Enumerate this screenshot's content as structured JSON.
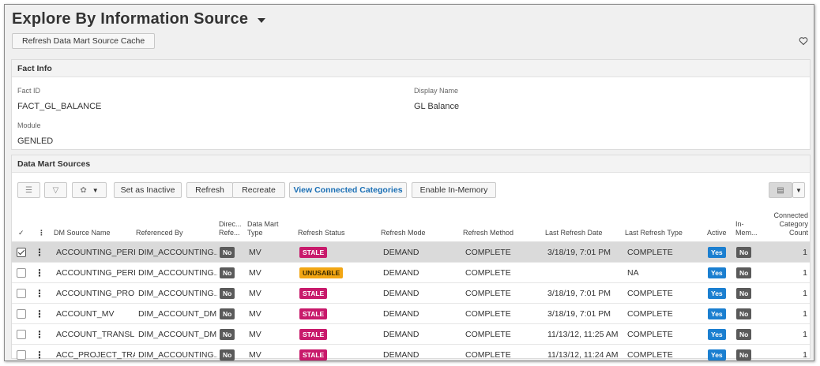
{
  "page": {
    "title": "Explore By Information Source",
    "refresh_cache_label": "Refresh Data Mart Source Cache"
  },
  "fact_info": {
    "header": "Fact Info",
    "fact_id_label": "Fact ID",
    "fact_id_value": "FACT_GL_BALANCE",
    "display_name_label": "Display Name",
    "display_name_value": "GL Balance",
    "module_label": "Module",
    "module_value": "GENLED"
  },
  "data_mart": {
    "header": "Data Mart Sources",
    "toolbar": {
      "set_inactive": "Set as Inactive",
      "refresh": "Refresh",
      "recreate": "Recreate",
      "view_connected": "View Connected Categories",
      "enable_in_memory": "Enable In-Memory"
    },
    "columns": {
      "check": "✓",
      "more": "⋮",
      "dm_source_name": "DM Source Name",
      "referenced_by": "Referenced By",
      "direct_ref_1": "Direc...",
      "direct_ref_2": "Refe...",
      "dm_type_1": "Data Mart",
      "dm_type_2": "Type",
      "refresh_status": "Refresh Status",
      "refresh_mode": "Refresh Mode",
      "refresh_method": "Refresh Method",
      "last_refresh_date": "Last Refresh Date",
      "last_refresh_type": "Last Refresh Type",
      "active": "Active",
      "in_memory_1": "In-",
      "in_memory_2": "Mem...",
      "conn_count_1": "Connected",
      "conn_count_2": "Category",
      "conn_count_3": "Count"
    },
    "rows": [
      {
        "selected": true,
        "name": "ACCOUNTING_PERI...",
        "ref_by": "DIM_ACCOUNTING...",
        "direct": "No",
        "type": "MV",
        "status": "STALE",
        "status_kind": "stale",
        "mode": "DEMAND",
        "method": "COMPLETE",
        "date": "3/18/19, 7:01 PM",
        "rtype": "COMPLETE",
        "active": "Yes",
        "inmem": "No",
        "count": "1"
      },
      {
        "selected": false,
        "name": "ACCOUNTING_PERI...",
        "ref_by": "DIM_ACCOUNTING...",
        "direct": "No",
        "type": "MV",
        "status": "UNUSABLE",
        "status_kind": "unusable",
        "mode": "DEMAND",
        "method": "COMPLETE",
        "date": "",
        "rtype": "NA",
        "active": "Yes",
        "inmem": "No",
        "count": "1"
      },
      {
        "selected": false,
        "name": "ACCOUNTING_PRO...",
        "ref_by": "DIM_ACCOUNTING...",
        "direct": "No",
        "type": "MV",
        "status": "STALE",
        "status_kind": "stale",
        "mode": "DEMAND",
        "method": "COMPLETE",
        "date": "3/18/19, 7:01 PM",
        "rtype": "COMPLETE",
        "active": "Yes",
        "inmem": "No",
        "count": "1"
      },
      {
        "selected": false,
        "name": "ACCOUNT_MV",
        "ref_by": "DIM_ACCOUNT_DM",
        "direct": "No",
        "type": "MV",
        "status": "STALE",
        "status_kind": "stale",
        "mode": "DEMAND",
        "method": "COMPLETE",
        "date": "3/18/19, 7:01 PM",
        "rtype": "COMPLETE",
        "active": "Yes",
        "inmem": "No",
        "count": "1"
      },
      {
        "selected": false,
        "name": "ACCOUNT_TRANSL...",
        "ref_by": "DIM_ACCOUNT_DM",
        "direct": "No",
        "type": "MV",
        "status": "STALE",
        "status_kind": "stale",
        "mode": "DEMAND",
        "method": "COMPLETE",
        "date": "11/13/12, 11:25 AM",
        "rtype": "COMPLETE",
        "active": "Yes",
        "inmem": "No",
        "count": "1"
      },
      {
        "selected": false,
        "name": "ACC_PROJECT_TRA...",
        "ref_by": "DIM_ACCOUNTING...",
        "direct": "No",
        "type": "MV",
        "status": "STALE",
        "status_kind": "stale",
        "mode": "DEMAND",
        "method": "COMPLETE",
        "date": "11/13/12, 11:24 AM",
        "rtype": "COMPLETE",
        "active": "Yes",
        "inmem": "No",
        "count": "1"
      }
    ]
  },
  "colors": {
    "stale": "#c81a6b",
    "unusable": "#f2a614",
    "yes": "#1b7fd0",
    "no": "#5a5a5a",
    "link": "#1a6fb5"
  },
  "icons": [
    "chevron-down-icon",
    "heart-icon",
    "list-icon",
    "filter-icon",
    "palette-icon",
    "grid-view-icon",
    "kebab-icon",
    "checkbox-icon"
  ]
}
